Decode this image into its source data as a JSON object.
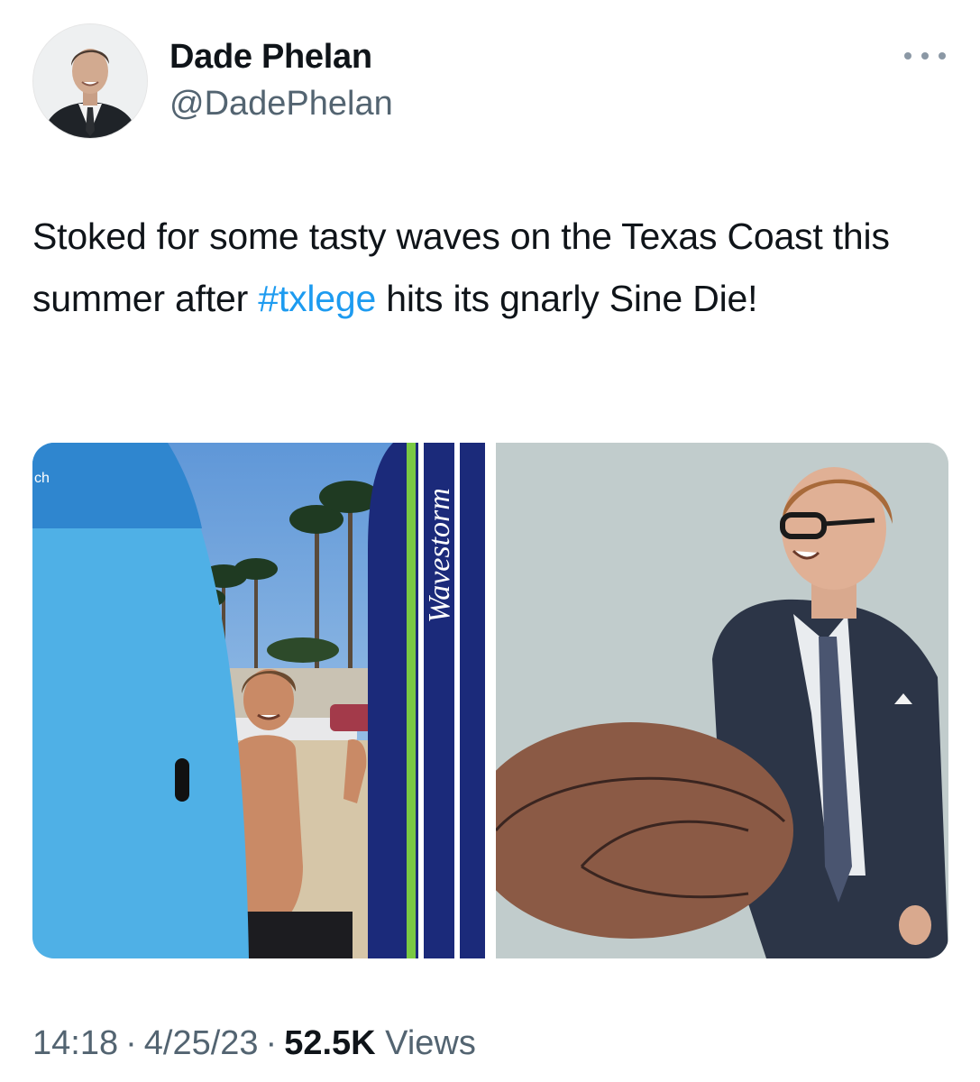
{
  "author": {
    "name": "Dade Phelan",
    "handle": "@DadePhelan",
    "avatar_icon": "profile-portrait"
  },
  "more_icon": "more-horizontal-icon",
  "tweet": {
    "text_before": "Stoked for some tasty waves on the Texas Coast this summer after ",
    "hashtag": "#txlege",
    "text_after": " hits its gnarly Sine Die!"
  },
  "media": {
    "photo_1": {
      "board_brand": "Wavestorm",
      "board_corner_text": "ch"
    },
    "photo_2": {}
  },
  "meta": {
    "time": "14:18",
    "separator": "·",
    "date": "4/25/23",
    "views_count": "52.5K",
    "views_label": "Views"
  },
  "colors": {
    "link": "#1d9bf0",
    "secondary_text": "#536471",
    "primary_text": "#0f1419"
  }
}
